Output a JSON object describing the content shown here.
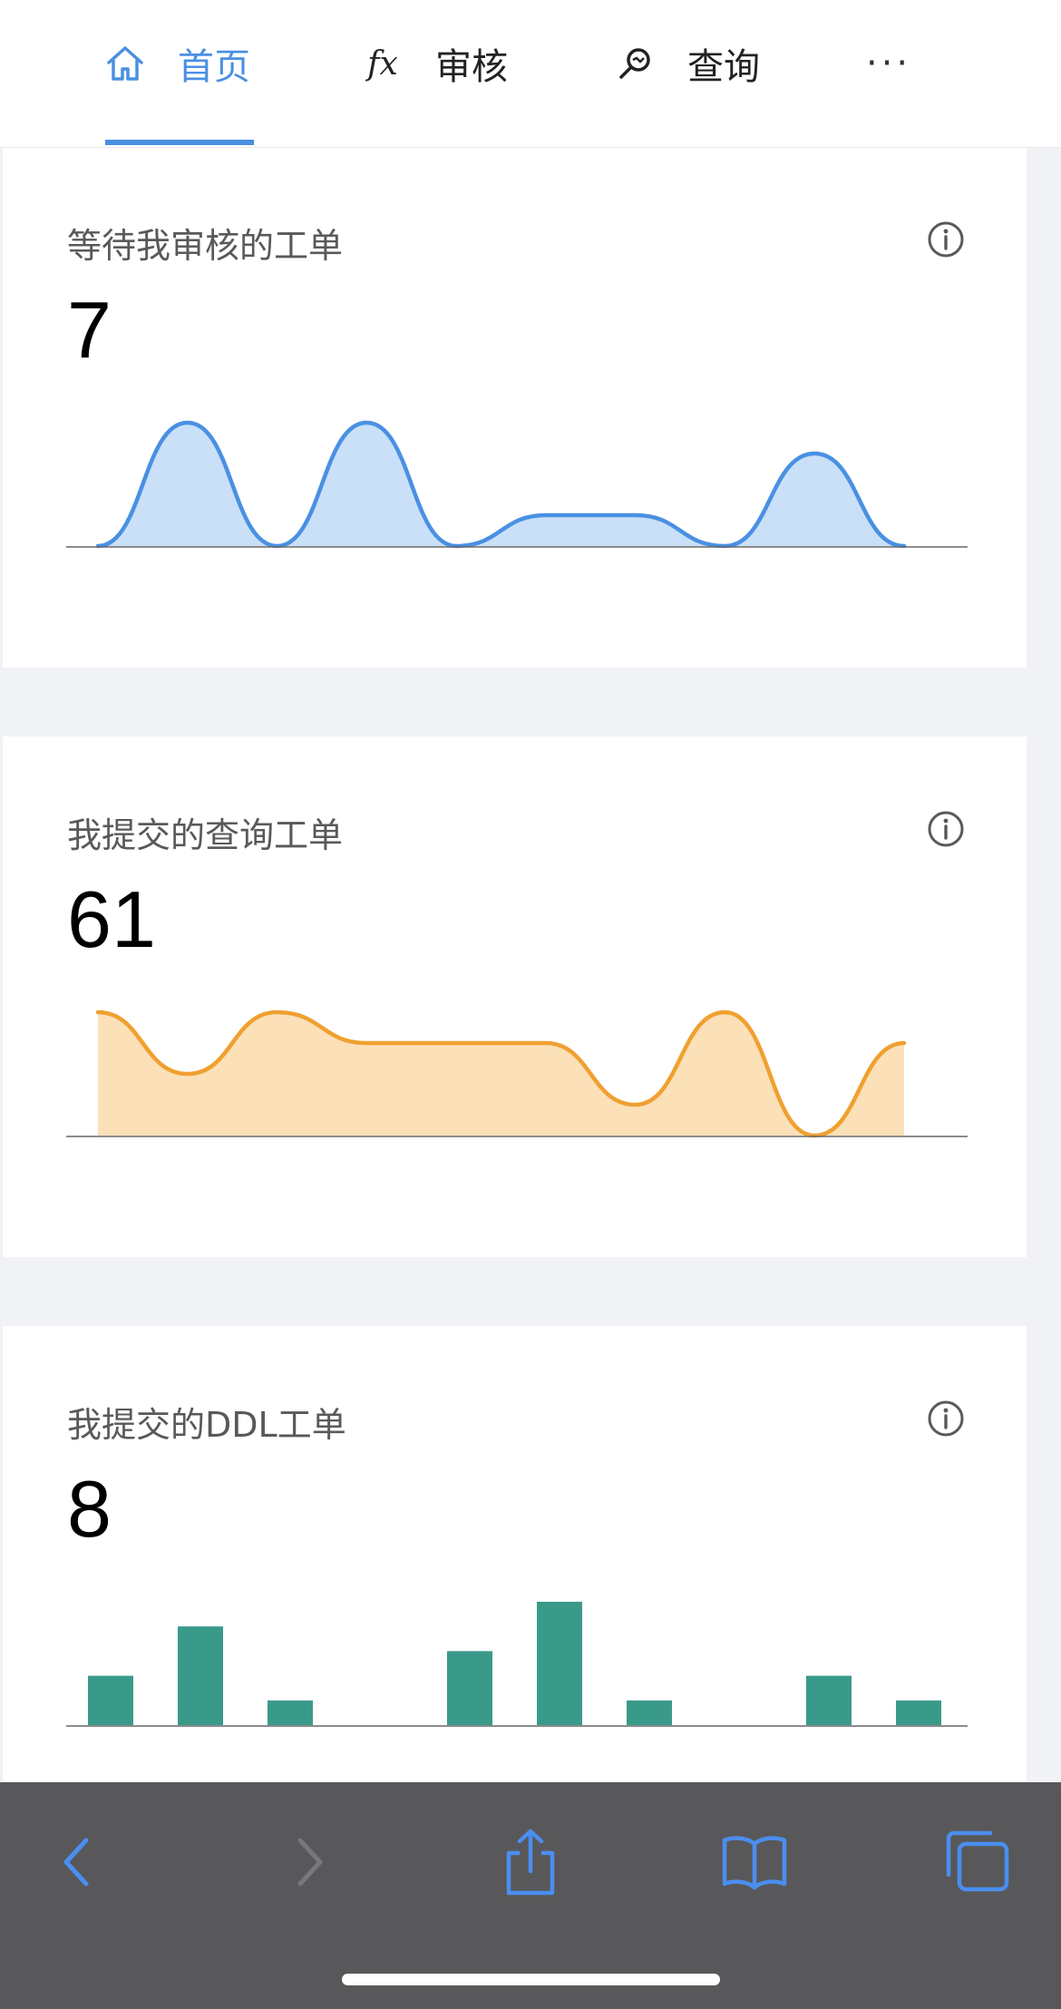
{
  "nav": {
    "items": [
      {
        "label": "首页",
        "icon": "home-icon",
        "active": true
      },
      {
        "label": "审核",
        "icon": "fx-icon",
        "icon_text": "fx",
        "active": false
      },
      {
        "label": "查询",
        "icon": "search-icon",
        "active": false
      }
    ],
    "more": "···",
    "accent": "#4a90e2"
  },
  "cards": [
    {
      "title": "等待我审核的工单",
      "value": "7",
      "info_icon": "info-icon",
      "color": "#4a90e2",
      "fill": "#c9e0f8"
    },
    {
      "title": "我提交的查询工单",
      "value": "61",
      "info_icon": "info-icon",
      "color": "#f0a030",
      "fill": "#fbe0b8"
    },
    {
      "title": "我提交的DDL工单",
      "value": "8",
      "info_icon": "info-icon",
      "color": "#3a9a8a"
    }
  ],
  "chart_data": [
    {
      "type": "area",
      "x": [
        0,
        1,
        2,
        3,
        4,
        5,
        6,
        7,
        8,
        9
      ],
      "values": [
        0,
        4,
        0,
        4,
        0,
        1,
        1,
        0,
        3,
        0
      ],
      "ylim": [
        0,
        4
      ],
      "smooth": true
    },
    {
      "type": "area",
      "x": [
        0,
        1,
        2,
        3,
        4,
        5,
        6,
        7,
        8,
        9
      ],
      "values": [
        8,
        6,
        8,
        7,
        7,
        7,
        5,
        8,
        4,
        7
      ],
      "ylim": [
        4,
        8
      ],
      "smooth": true
    },
    {
      "type": "bar",
      "categories": [
        0,
        1,
        2,
        3,
        4,
        5,
        6,
        7,
        8,
        9
      ],
      "values": [
        2,
        4,
        1,
        0,
        3,
        5,
        1,
        0,
        2,
        1
      ],
      "ylim": [
        0,
        5
      ]
    }
  ],
  "browser_bar": {
    "buttons": [
      "back-icon",
      "forward-icon",
      "share-icon",
      "bookmarks-icon",
      "tabs-icon"
    ],
    "active_color": "#4a8ef0",
    "disabled_color": "#78787a"
  }
}
